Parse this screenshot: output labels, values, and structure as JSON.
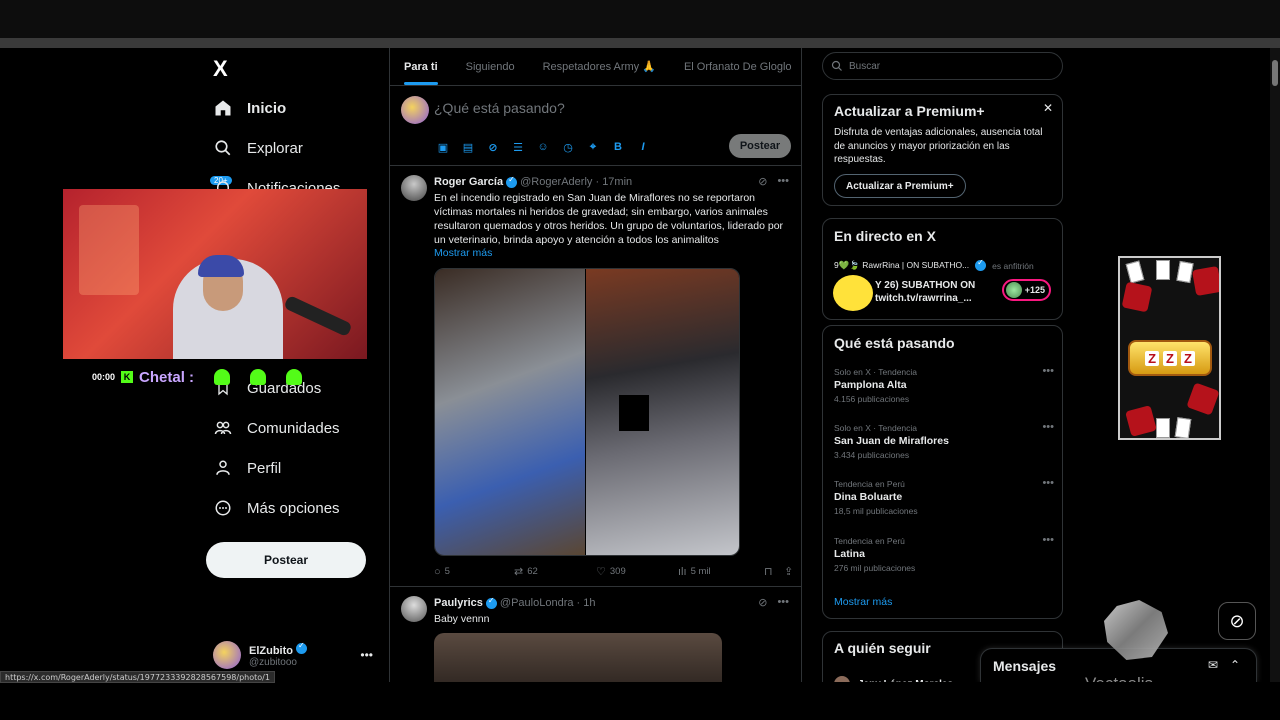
{
  "nav": {
    "logo": "X",
    "items": [
      {
        "label": "Inicio",
        "icon": "home-icon"
      },
      {
        "label": "Explorar",
        "icon": "search-icon"
      },
      {
        "label": "Notificaciones",
        "icon": "bell-icon"
      },
      {
        "label": "Guardados",
        "icon": "bookmark-icon"
      },
      {
        "label": "Comunidades",
        "icon": "communities-icon"
      },
      {
        "label": "Perfil",
        "icon": "person-icon"
      },
      {
        "label": "Más opciones",
        "icon": "more-circle-icon"
      }
    ],
    "notif_badge": "20+",
    "post_button": "Postear",
    "account": {
      "name": "ElZubito",
      "handle": "@zubitooo"
    }
  },
  "stream_overlay": {
    "chat_time": "00:00",
    "chat_platform": "K",
    "chat_user": "Chetal :"
  },
  "main": {
    "tabs": [
      "Para ti",
      "Siguiendo",
      "Respetadores Army 🙏",
      "El Orfanato De Gloglo"
    ],
    "active_tab": "Para ti",
    "compose_placeholder": "¿Qué está pasando?",
    "compose_post_button": "Postear",
    "compose_tools": [
      "image-icon",
      "gif-icon",
      "grok-icon",
      "poll-icon",
      "emoji-icon",
      "schedule-icon",
      "location-icon",
      "bold-icon",
      "italic-icon"
    ],
    "tweets": [
      {
        "name": "Roger García",
        "handle": "@RogerAderly",
        "time": "· 17min",
        "text": "En el incendio registrado en San Juan de Miraflores no se reportaron víctimas mortales ni heridos de gravedad; sin embargo, varios animales resultaron quemados y otros heridos. Un grupo de voluntarios, liderado por un veterinario, brinda apoyo y atención a todos los animalitos",
        "show_more": "Mostrar más",
        "replies": "5",
        "reposts": "62",
        "likes": "309",
        "views": "5 mil"
      },
      {
        "name": "Paulyrics",
        "handle": "@PauloLondra",
        "time": "· 1h",
        "text": "Baby vennn"
      }
    ]
  },
  "right": {
    "search_placeholder": "Buscar",
    "premium": {
      "title": "Actualizar a Premium+",
      "description": "Disfruta de ventajas adicionales, ausencia total de anuncios y mayor priorización en las respuestas.",
      "button": "Actualizar a Premium+"
    },
    "live": {
      "title": "En directo en X",
      "host_line": "9💚🍃 RawrRina | ON SUBATHO...",
      "host_label": "es anfitrión",
      "stream_title": "Y 26) SUBATHON ON twitch.tv/rawrrina_...",
      "listeners": "+125"
    },
    "trends": {
      "title": "Qué está pasando",
      "items": [
        {
          "context": "Solo en X · Tendencia",
          "name": "Pamplona Alta",
          "count": "4.156 publicaciones"
        },
        {
          "context": "Solo en X · Tendencia",
          "name": "San Juan de Miraflores",
          "count": "3.434 publicaciones"
        },
        {
          "context": "Tendencia en Perú",
          "name": "Dina Boluarte",
          "count": "18,5 mil publicaciones"
        },
        {
          "context": "Tendencia en Perú",
          "name": "Latina",
          "count": "276 mil publicaciones"
        }
      ],
      "show_more": "Mostrar más"
    },
    "who_to_follow": {
      "title": "A quién seguir",
      "first_user": "Jeny López Morales"
    }
  },
  "messages": {
    "title": "Mensajes"
  },
  "status_url": "https://x.com/RogerAderly/status/1977233392828567598/photo/1",
  "watermark": "Vectaelis",
  "colors": {
    "accent": "#1d9bf0",
    "background": "#000000",
    "border": "#2f3336",
    "muted": "#71767b"
  }
}
